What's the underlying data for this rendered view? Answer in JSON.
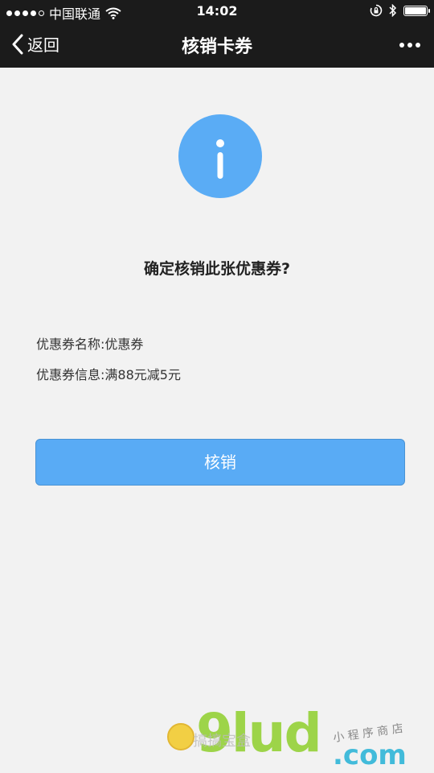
{
  "status_bar": {
    "carrier": "中国联通",
    "time": "14:02"
  },
  "nav": {
    "back_label": "返回",
    "title": "核销卡券"
  },
  "content": {
    "confirm_text": "确定核销此张优惠券?",
    "details": [
      {
        "label": "优惠券名称:",
        "value": "优惠券"
      },
      {
        "label": "优惠券信息:",
        "value": "满88元减5元"
      }
    ],
    "verify_button_label": "核销"
  },
  "watermark": {
    "small_text": "搞搞宝盒",
    "big_text": "9lud",
    "domain": ".com",
    "handwriting": "小 程 序 商 店"
  },
  "colors": {
    "header_bg": "#1b1b1b",
    "page_bg": "#f2f2f2",
    "accent": "#59abf5"
  },
  "icons": {
    "info": "info-circle-icon",
    "back": "chevron-left-icon",
    "more": "more-dots-icon",
    "wifi": "wifi-icon",
    "lock": "rotation-lock-icon",
    "bluetooth": "bluetooth-icon",
    "battery": "battery-icon"
  },
  "battery_level": 1.0
}
